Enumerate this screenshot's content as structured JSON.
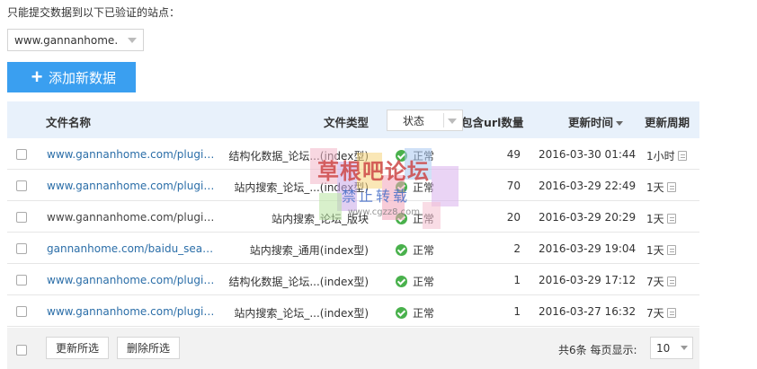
{
  "intro_text": "只能提交数据到以下已验证的站点：",
  "site_select": {
    "value": "www.gannanhome.c"
  },
  "add_button_label": "添加新数据",
  "table": {
    "headers": {
      "file_name": "文件名称",
      "file_type": "文件类型",
      "status": "状态",
      "url_count": "包含url数量",
      "update_time": "更新时间",
      "update_period": "更新周期"
    },
    "rows": [
      {
        "file_name": "www.gannanhome.com/plugin.p...",
        "file_type": "结构化数据_论坛...(index型)",
        "status": "正常",
        "url_count": "49",
        "update_time": "2016-03-30 01:44",
        "update_period": "1小时"
      },
      {
        "file_name": "www.gannanhome.com/plugin.p...",
        "file_type": "站内搜索_论坛_...(index型)",
        "status": "正常",
        "url_count": "70",
        "update_time": "2016-03-29 22:49",
        "update_period": "1天"
      },
      {
        "file_name": "www.gannanhome.com/plugin.p...",
        "file_type": "站内搜索_论坛_版块",
        "status": "正常",
        "url_count": "20",
        "update_time": "2016-03-29 20:29",
        "update_period": "1天"
      },
      {
        "file_name": "gannanhome.com/baidu_search...",
        "file_type": "站内搜索_通用(index型)",
        "status": "正常",
        "url_count": "2",
        "update_time": "2016-03-29 19:04",
        "update_period": "1天"
      },
      {
        "file_name": "www.gannanhome.com/plugin.p...",
        "file_type": "结构化数据_论坛...(index型)",
        "status": "正常",
        "url_count": "1",
        "update_time": "2016-03-29 17:12",
        "update_period": "7天"
      },
      {
        "file_name": "www.gannanhome.com/plugin.p...",
        "file_type": "站内搜索_论坛_...(index型)",
        "status": "正常",
        "url_count": "1",
        "update_time": "2016-03-27 16:32",
        "update_period": "7天"
      }
    ]
  },
  "footer": {
    "update_selected": "更新所选",
    "delete_selected": "删除所选",
    "pager_text": "共6条 每页显示:",
    "page_size": "10"
  },
  "watermark": {
    "title": "草根吧论坛",
    "subtitle": "禁止转载",
    "url": "www.cgzz8.com"
  },
  "colors": {
    "accent": "#3a9ff0",
    "header_bg": "#e8f1fb",
    "link": "#2b6ea8",
    "ok": "#49b14c"
  }
}
